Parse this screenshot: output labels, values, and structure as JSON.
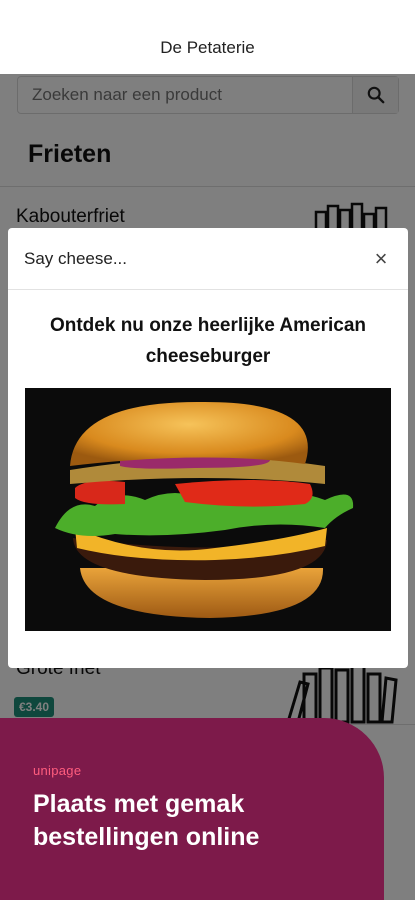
{
  "header": {
    "title": "De Petaterie"
  },
  "search": {
    "placeholder": "Zoeken naar een product",
    "icon": "search-icon"
  },
  "category": {
    "title": "Frieten"
  },
  "products": [
    {
      "name": "Kabouterfriet"
    },
    {
      "name": "Grote friet",
      "price": "€3.40"
    }
  ],
  "modal": {
    "title": "Say cheese...",
    "close_label": "×",
    "heading": "Ontdek nu onze heerlijke American cheeseburger",
    "image_alt": "cheeseburger"
  },
  "promo": {
    "logo": "unipage",
    "text": "Plaats met gemak bestellingen online",
    "background": "#7d1a4a",
    "logo_color": "#ff5d7e"
  },
  "colors": {
    "price_badge": "#1f8f7a"
  }
}
